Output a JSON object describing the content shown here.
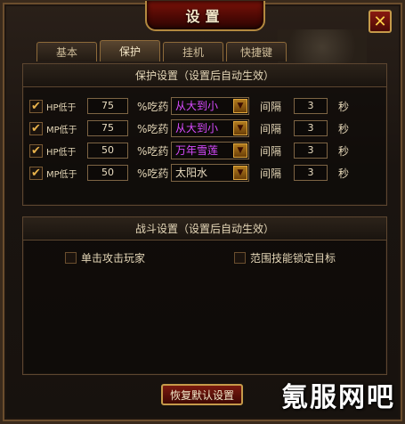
{
  "window": {
    "title": "设置",
    "close_label": "✕"
  },
  "tabs": [
    {
      "label": "基本",
      "active": false
    },
    {
      "label": "保护",
      "active": true
    },
    {
      "label": "挂机",
      "active": false
    },
    {
      "label": "快捷键",
      "active": false
    }
  ],
  "protect": {
    "heading": "保护设置（设置后自动生效）",
    "rows": [
      {
        "checked": true,
        "label": "HP低于",
        "value": "75",
        "unit": "%吃药",
        "item": "从大到小",
        "item_color": "#d84bff",
        "interval_label": "间隔",
        "interval": "3",
        "sec": "秒"
      },
      {
        "checked": true,
        "label": "MP低于",
        "value": "75",
        "unit": "%吃药",
        "item": "从大到小",
        "item_color": "#d84bff",
        "interval_label": "间隔",
        "interval": "3",
        "sec": "秒"
      },
      {
        "checked": true,
        "label": "HP低于",
        "value": "50",
        "unit": "%吃药",
        "item": "万年雪莲",
        "item_color": "#d84bff",
        "interval_label": "间隔",
        "interval": "3",
        "sec": "秒"
      },
      {
        "checked": true,
        "label": "MP低于",
        "value": "50",
        "unit": "%吃药",
        "item": "太阳水",
        "item_color": "#e9dcc0",
        "interval_label": "间隔",
        "interval": "3",
        "sec": "秒"
      }
    ]
  },
  "battle": {
    "heading": "战斗设置（设置后自动生效）",
    "options": [
      {
        "label": "单击攻击玩家",
        "checked": false
      },
      {
        "label": "范围技能锁定目标",
        "checked": false
      }
    ]
  },
  "reset_button": "恢复默认设置",
  "watermark": "氪服网吧"
}
